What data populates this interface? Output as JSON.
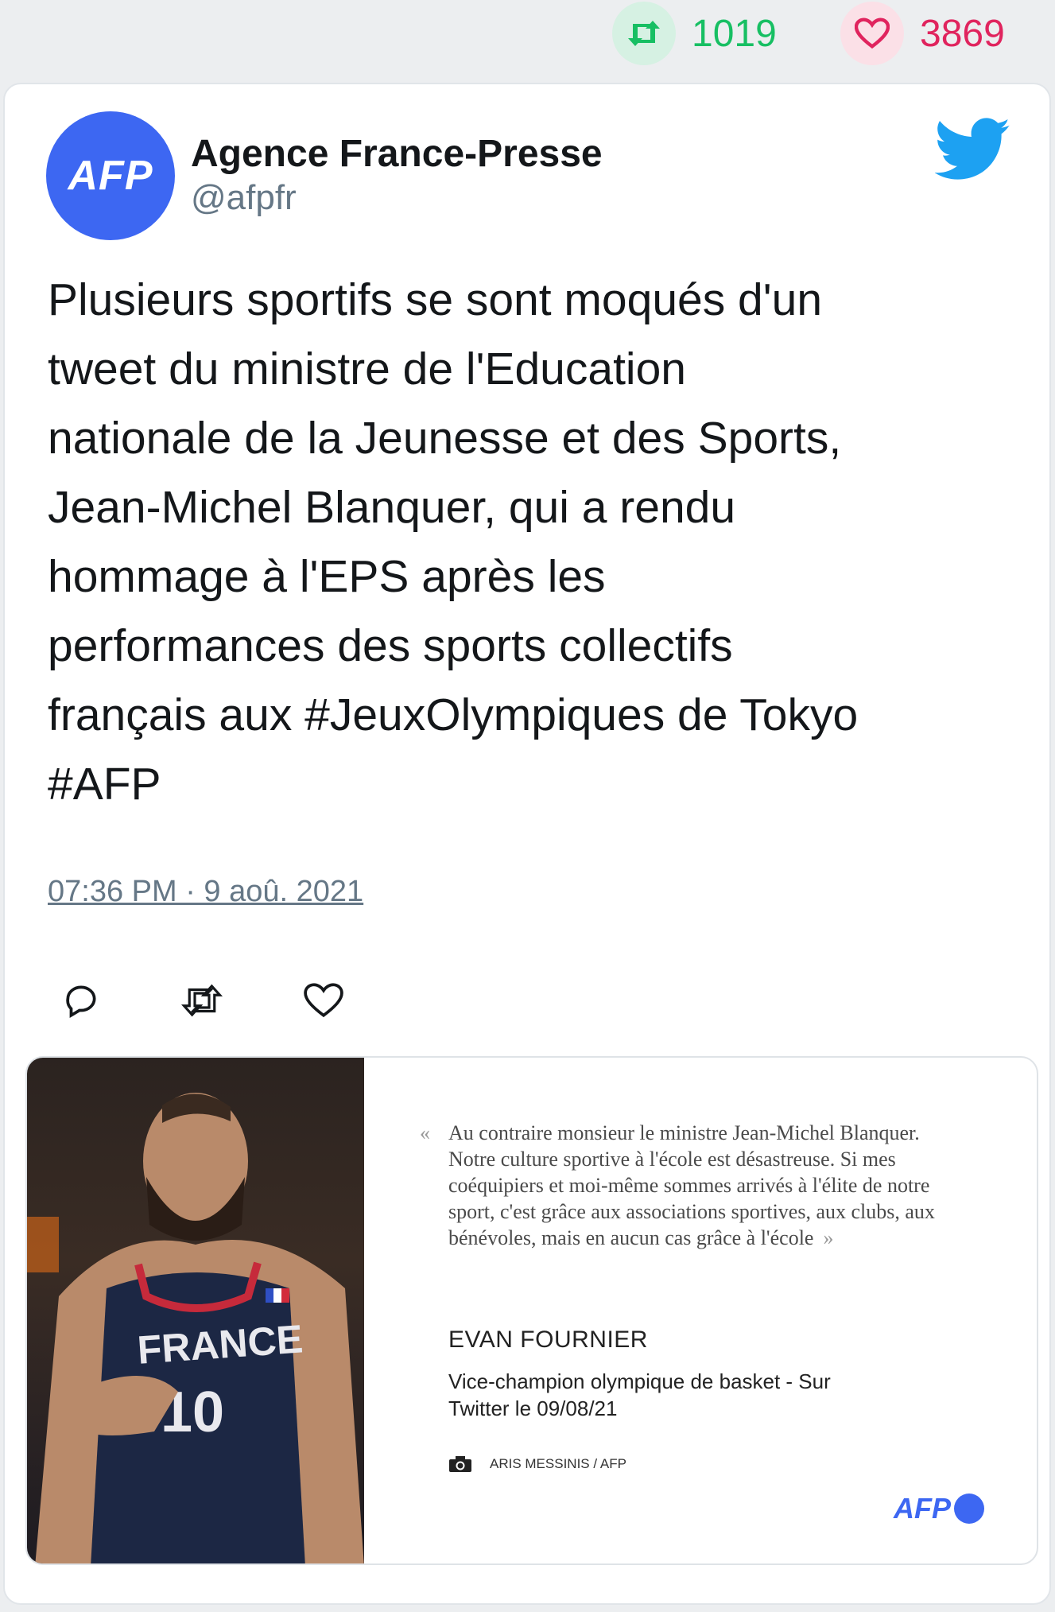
{
  "stats": {
    "retweets": "1019",
    "likes": "3869"
  },
  "tweet": {
    "author_name": "Agence France-Presse",
    "author_handle": "@afpfr",
    "avatar_text": "AFP",
    "text": "Plusieurs sportifs se sont moqués d'un\ntweet du ministre de l'Education\nnationale de la Jeunesse et des Sports,\nJean-Michel Blanquer, qui a rendu\nhommage à l'EPS après les\nperformances des sports collectifs\nfrançais aux #JeuxOlympiques de Tokyo\n#AFP",
    "timestamp": "07:36 PM · 9 aoû. 2021"
  },
  "media": {
    "quote_open": "«",
    "quote": "Au contraire monsieur le ministre Jean-Michel Blanquer. Notre culture sportive à l'école est désastreuse. Si mes coéquipiers et moi-même sommes arrivés à l'élite de notre sport, c'est grâce aux associations sportives, aux clubs, aux bénévoles, mais en aucun cas grâce à l'école",
    "quote_close": "»",
    "author": "EVAN FOURNIER",
    "role": "Vice-champion olympique de basket - Sur Twitter le 09/08/21",
    "credit": "ARIS MESSINIS / AFP",
    "logo_text": "AFP",
    "jersey_text": "FRANCE",
    "jersey_number": "10"
  },
  "colors": {
    "retweet": "#17bf63",
    "like": "#e0245e",
    "twitter_blue": "#1da1f2",
    "afp_blue": "#3d67f2"
  },
  "icons": [
    "retweet-icon",
    "heart-icon",
    "twitter-bird-icon",
    "reply-icon",
    "camera-icon"
  ]
}
